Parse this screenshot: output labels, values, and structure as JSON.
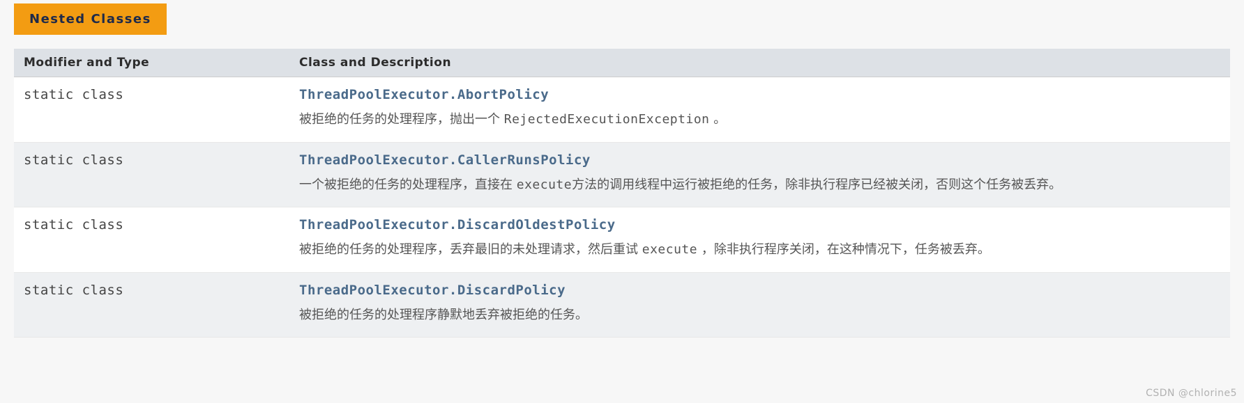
{
  "section_title": "Nested Classes",
  "header": {
    "col1": "Modifier and Type",
    "col2": "Class and Description"
  },
  "rows": [
    {
      "modifier": "static class ",
      "class_name": "ThreadPoolExecutor.AbortPolicy",
      "desc_pre": "被拒绝的任务的处理程序，抛出一个 ",
      "desc_code": "RejectedExecutionException",
      "desc_post": " 。"
    },
    {
      "modifier": "static class ",
      "class_name": "ThreadPoolExecutor.CallerRunsPolicy",
      "desc_pre": "一个被拒绝的任务的处理程序，直接在 ",
      "desc_code": "execute",
      "desc_post": "方法的调用线程中运行被拒绝的任务，除非执行程序已经被关闭，否则这个任务被丢弃。"
    },
    {
      "modifier": "static class ",
      "class_name": "ThreadPoolExecutor.DiscardOldestPolicy",
      "desc_pre": "被拒绝的任务的处理程序，丢弃最旧的未处理请求，然后重试 ",
      "desc_code": "execute",
      "desc_post": " ，除非执行程序关闭，在这种情况下，任务被丢弃。"
    },
    {
      "modifier": "static class ",
      "class_name": "ThreadPoolExecutor.DiscardPolicy",
      "desc_pre": "被拒绝的任务的处理程序静默地丢弃被拒绝的任务。",
      "desc_code": "",
      "desc_post": ""
    }
  ],
  "watermark": "CSDN @chlorine5"
}
